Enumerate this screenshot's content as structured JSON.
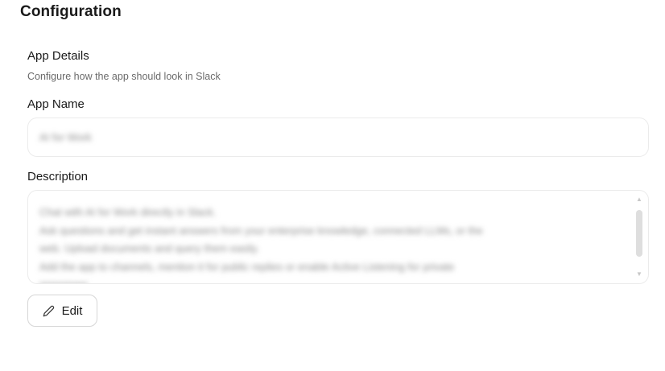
{
  "page": {
    "title": "Configuration"
  },
  "section": {
    "title": "App Details",
    "subtitle": "Configure how the app should look in Slack"
  },
  "fields": {
    "app_name": {
      "label": "App Name",
      "value": "AI for Work"
    },
    "description": {
      "label": "Description",
      "lines": [
        "Chat with AI for Work directly in Slack.",
        "Ask questions and get instant answers from your enterprise knowledge, connected LLMs, or the",
        "web. Upload documents and query them easily.",
        "Add the app to channels, mention it for public replies or enable Active Listening for private",
        "responses."
      ]
    }
  },
  "actions": {
    "edit_label": "Edit"
  },
  "icons": {
    "edit": "pencil-icon"
  }
}
